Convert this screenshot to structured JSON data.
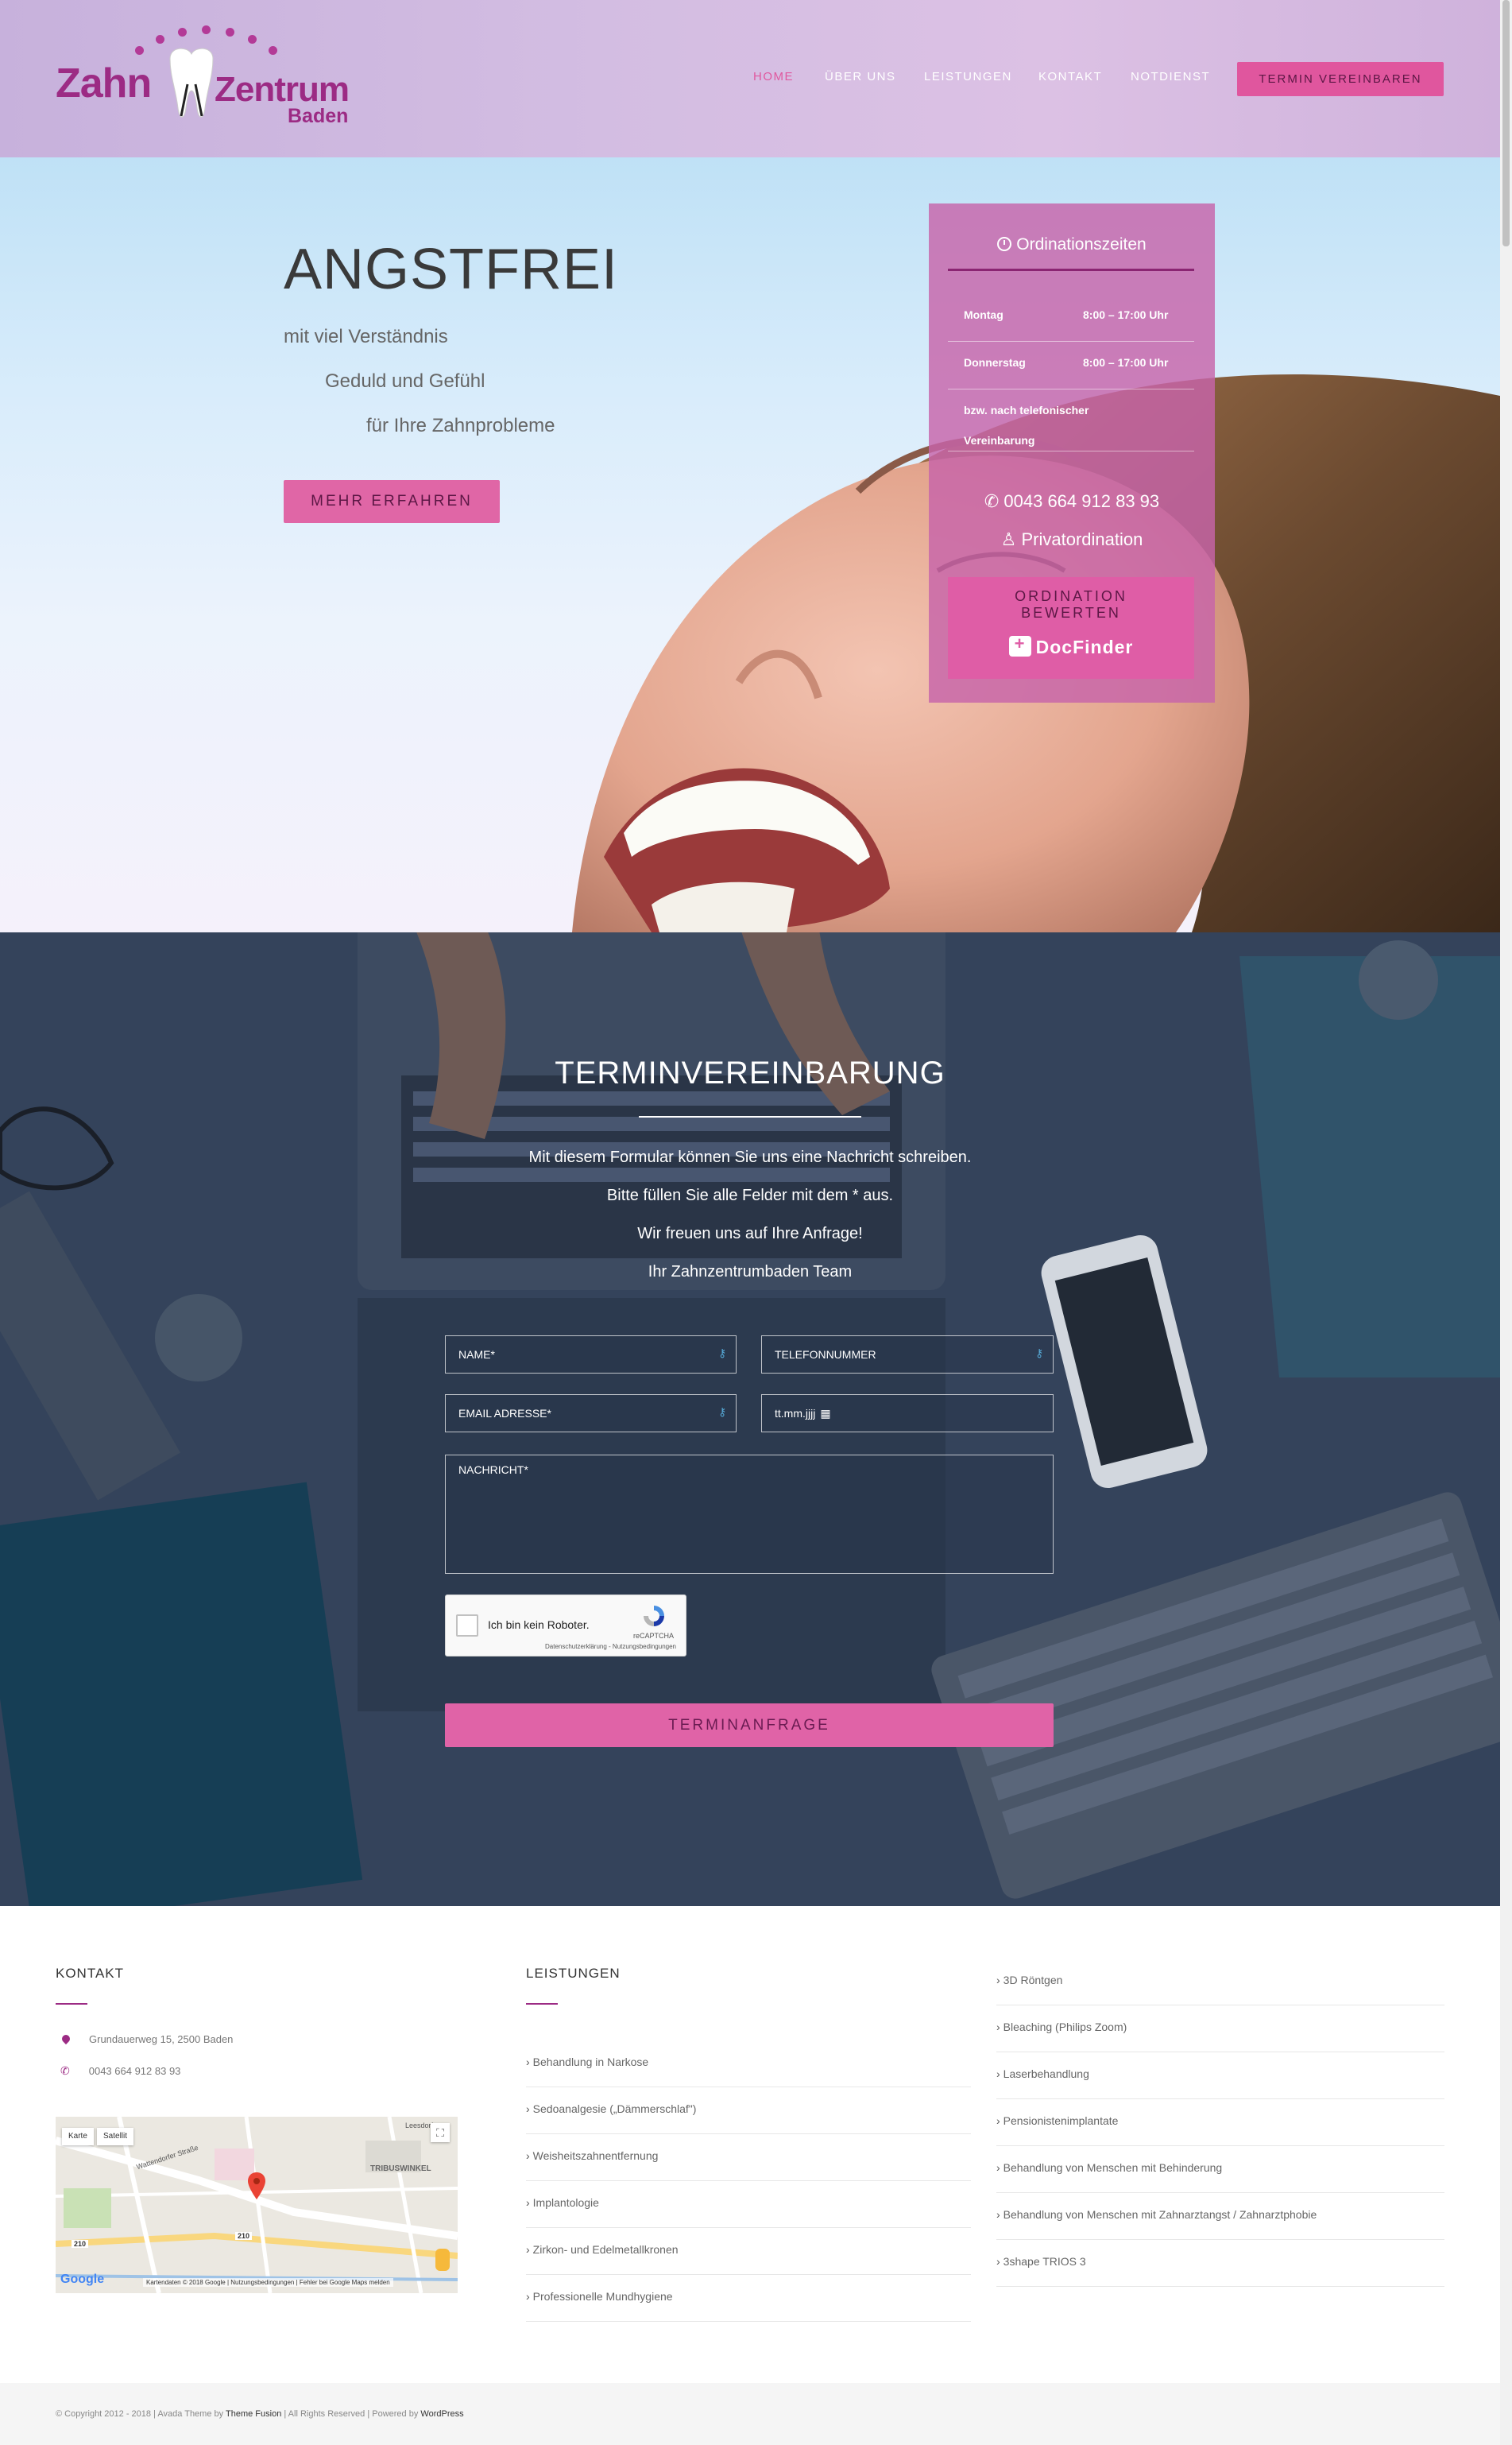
{
  "logo": {
    "word1": "Zahn",
    "word2": "Zentrum",
    "word3": "Baden"
  },
  "nav": {
    "items": [
      "HOME",
      "ÜBER UNS",
      "LEISTUNGEN",
      "KONTAKT",
      "NOTDIENST"
    ],
    "cta": "TERMIN VEREINBAREN"
  },
  "hero": {
    "title": "ANGSTFREI",
    "lines": [
      "mit viel Verständnis",
      "Geduld und Gefühl",
      "für Ihre Zahnprobleme"
    ],
    "button": "MEHR ERFAHREN"
  },
  "hours": {
    "title": "Ordinationszeiten",
    "rows": [
      {
        "day": "Montag",
        "time": "8:00 – 17:00 Uhr"
      },
      {
        "day": "Donnerstag",
        "time": "8:00 – 17:00 Uhr"
      }
    ],
    "note_line1": "bzw. nach telefonischer",
    "note_line2": "Vereinbarung",
    "phone": "0043 664 912 83 93",
    "private": "Privatordination",
    "rate_line1": "ORDINATION",
    "rate_line2": "BEWERTEN",
    "docfinder": "DocFinder"
  },
  "form": {
    "title": "TERMINVEREINBARUNG",
    "lines": [
      "Mit diesem Formular können Sie uns eine Nachricht schreiben.",
      "Bitte füllen Sie alle Felder mit dem * aus.",
      "Wir freuen uns auf Ihre Anfrage!",
      "Ihr Zahnzentrumbaden Team"
    ],
    "name_placeholder": "NAME*",
    "phone_placeholder": "TELEFONNUMMER",
    "email_placeholder": "EMAIL ADRESSE*",
    "date_placeholder": "tt.mm.jjjj",
    "message_placeholder": "NACHRICHT*",
    "captcha_label": "Ich bin kein Roboter.",
    "captcha_brand": "reCAPTCHA",
    "captcha_links": "Datenschutzerklärung - Nutzungsbedingungen",
    "submit": "TERMINANFRAGE"
  },
  "footer": {
    "contact_title": "KONTAKT",
    "address": "Grundauerweg 15, 2500 Baden",
    "phone": "0043 664 912 83 93",
    "map": {
      "btn_map": "Karte",
      "btn_sat": "Satellit",
      "google": "Google",
      "attribution": "Kartendaten © 2018 Google | Nutzungsbedingungen | Fehler bei Google Maps melden",
      "labels": [
        "Wattendorfer Straße",
        "Leesdorfer",
        "TRIBUSWINKEL",
        "210",
        "210"
      ]
    },
    "services_title": "LEISTUNGEN",
    "services_col1": [
      "Behandlung in Narkose",
      "Sedoanalgesie („Dämmerschlaf\")",
      "Weisheitszahnentfernung",
      "Implantologie",
      "Zirkon- und Edelmetallkronen",
      "Professionelle Mundhygiene"
    ],
    "services_col2": [
      "3D Röntgen",
      "Bleaching (Philips Zoom)",
      "Laserbehandlung",
      "Pensionistenimplantate",
      "Behandlung von Menschen mit Behinderung",
      "Behandlung von Menschen mit Zahnarztangst / Zahnarztphobie",
      "3shape TRIOS 3"
    ]
  },
  "copyright": {
    "prefix": "© Copyright 2012 - 2018 | Avada Theme by",
    "themefusion": "Theme Fusion",
    "middle": "| All Rights Reserved | Powered by",
    "wordpress": "WordPress"
  },
  "colors": {
    "brand": "#9c2b84",
    "accent": "#e0569e",
    "hours_box": "#c764aa",
    "form_bg": "#33425a"
  }
}
